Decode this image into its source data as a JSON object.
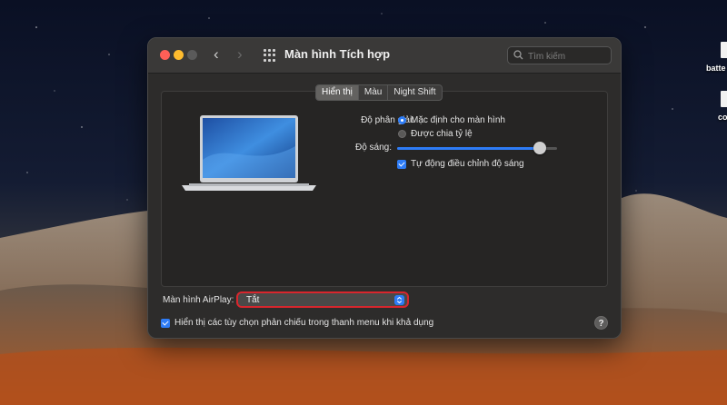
{
  "desktop": {
    "icons": [
      {
        "label": "batte",
        "icon": "file-icon"
      },
      {
        "label": "co",
        "icon": "file-icon"
      }
    ]
  },
  "window": {
    "title": "Màn hình Tích hợp",
    "search": {
      "placeholder": "Tìm kiếm",
      "value": ""
    },
    "tabs": [
      {
        "label": "Hiển thị",
        "active": true
      },
      {
        "label": "Màu",
        "active": false
      },
      {
        "label": "Night Shift",
        "active": false
      }
    ],
    "resolution": {
      "label": "Độ phân giải:",
      "options": [
        {
          "label": "Mặc định cho màn hình",
          "selected": true
        },
        {
          "label": "Được chia tỷ lệ",
          "selected": false
        }
      ]
    },
    "brightness": {
      "label": "Độ sáng:",
      "value": 0.89
    },
    "auto_brightness": {
      "label": "Tự động điều chỉnh độ sáng",
      "checked": true
    },
    "airplay": {
      "label": "Màn hình AirPlay:",
      "value": "Tắt"
    },
    "menu_option": {
      "label": "Hiển thị các tùy chọn phản chiếu trong thanh menu khi khả dụng",
      "checked": true
    },
    "help": "?"
  },
  "colors": {
    "accent": "#2e7cf6",
    "highlight_border": "#d8262d",
    "traffic_close": "#fe5f57",
    "traffic_min": "#febc2e",
    "traffic_max": "#5a5a5a"
  }
}
